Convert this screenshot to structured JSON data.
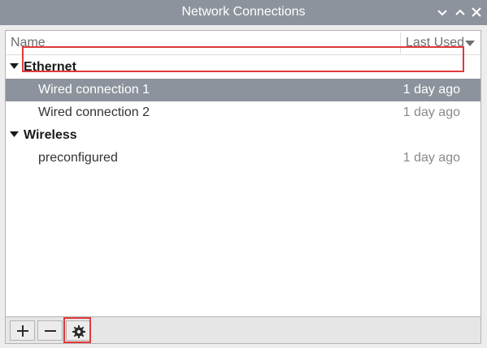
{
  "window": {
    "title": "Network Connections"
  },
  "columns": {
    "name": "Name",
    "last_used": "Last Used"
  },
  "groups": [
    {
      "label": "Ethernet",
      "items": [
        {
          "name": "Wired connection 1",
          "last_used": "1 day ago",
          "selected": true
        },
        {
          "name": "Wired connection 2",
          "last_used": "1 day ago",
          "selected": false
        }
      ]
    },
    {
      "label": "Wireless",
      "items": [
        {
          "name": "preconfigured",
          "last_used": "1 day ago",
          "selected": false
        }
      ]
    }
  ],
  "toolbar": {
    "add_icon": "plus-icon",
    "remove_icon": "minus-icon",
    "settings_icon": "gear-icon"
  },
  "colors": {
    "titlebar": "#8d939c",
    "selection": "#8d939c",
    "highlight": "#e0393b"
  }
}
